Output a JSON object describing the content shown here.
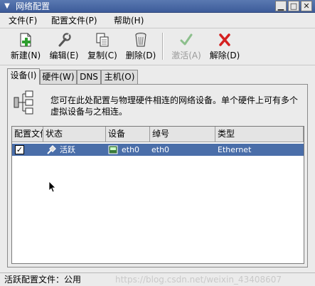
{
  "window": {
    "title": "网络配置"
  },
  "menu": [
    {
      "label": "文件(F)"
    },
    {
      "label": "配置文件(P)"
    },
    {
      "label": "帮助(H)"
    }
  ],
  "toolbar": {
    "new": "新建(N)",
    "edit": "编辑(E)",
    "copy": "复制(C)",
    "delete": "删除(D)",
    "activate": "激活(A)",
    "deactivate": "解除(D)"
  },
  "tabs": [
    {
      "label": "设备(I)",
      "active": true
    },
    {
      "label": "硬件(W)"
    },
    {
      "label": "DNS"
    },
    {
      "label": "主机(O)"
    }
  ],
  "panel": {
    "description": "您可在此处配置与物理硬件相连的网络设备。单个硬件上可有多个虚拟设备与之相连。"
  },
  "table": {
    "columns": [
      "配置文件",
      "状态",
      "设备",
      "绰号",
      "类型"
    ],
    "rows": [
      {
        "checked": true,
        "status": "活跃",
        "device": "eth0",
        "nickname": "eth0",
        "type": "Ethernet"
      }
    ]
  },
  "status": {
    "text": "活跃配置文件：公用",
    "watermark": "https://blog.csdn.net/weixin_43408607"
  }
}
